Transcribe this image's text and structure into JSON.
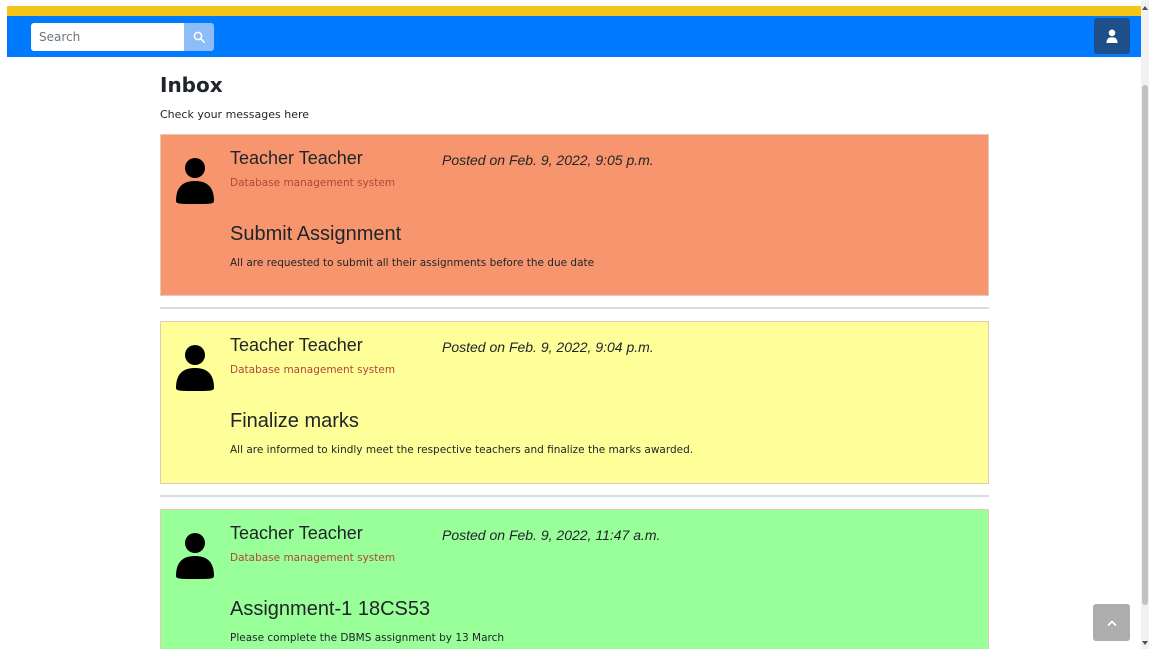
{
  "navbar": {
    "search": {
      "placeholder": "Search",
      "value": ""
    },
    "search_icon": "search-icon",
    "user_icon": "user-icon",
    "colors": {
      "accent_strip": "#f5c518",
      "bar": "#007bff",
      "user_button": "#1e4f8a"
    }
  },
  "page": {
    "title": "Inbox",
    "subtitle": "Check your messages here"
  },
  "messages": [
    {
      "sender": "Teacher Teacher",
      "posted": "Posted on Feb. 9, 2022, 9:05 p.m.",
      "course": "Database management system",
      "title": "Submit Assignment",
      "body": "All are requested to submit all their assignments before the due date",
      "color": "#f7966e"
    },
    {
      "sender": "Teacher Teacher",
      "posted": "Posted on Feb. 9, 2022, 9:04 p.m.",
      "course": "Database management system",
      "title": "Finalize marks",
      "body": "All are informed to kindly meet the respective teachers and finalize the marks awarded.",
      "color": "#ffff99"
    },
    {
      "sender": "Teacher Teacher",
      "posted": "Posted on Feb. 9, 2022, 11:47 a.m.",
      "course": "Database management system",
      "title": "Assignment-1 18CS53",
      "body": "Please complete the DBMS assignment by 13 March",
      "color": "#99ff99"
    }
  ],
  "back_to_top_icon": "chevron-up-icon"
}
